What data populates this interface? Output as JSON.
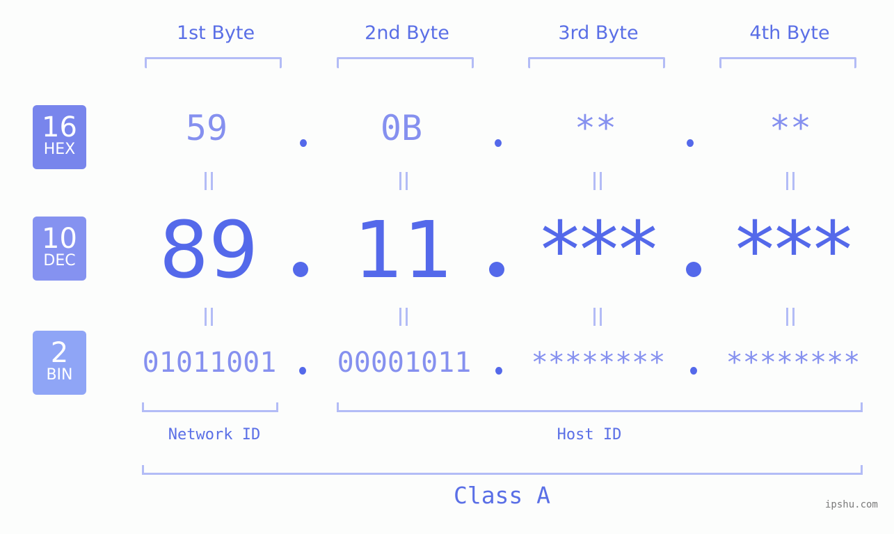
{
  "bytes": [
    {
      "header": "1st Byte",
      "hex": "59",
      "dec": "89",
      "bin": "01011001"
    },
    {
      "header": "2nd Byte",
      "hex": "0B",
      "dec": "11",
      "bin": "00001011"
    },
    {
      "header": "3rd Byte",
      "hex": "**",
      "dec": "***",
      "bin": "********"
    },
    {
      "header": "4th Byte",
      "hex": "**",
      "dec": "***",
      "bin": "********"
    }
  ],
  "badges": {
    "hex": {
      "num": "16",
      "label": "HEX",
      "color": "#7885ec"
    },
    "dec": {
      "num": "10",
      "label": "DEC",
      "color": "#8592f0"
    },
    "bin": {
      "num": "2",
      "label": "BIN",
      "color": "#8fa5f6"
    }
  },
  "segments": {
    "network": "Network ID",
    "host": "Host ID",
    "class": "Class A"
  },
  "watermark": "ipshu.com",
  "colors": {
    "accent": "#5469ea",
    "light_text": "#8590ef",
    "bracket": "#b3bcf6",
    "background": "#fcfdfc"
  }
}
